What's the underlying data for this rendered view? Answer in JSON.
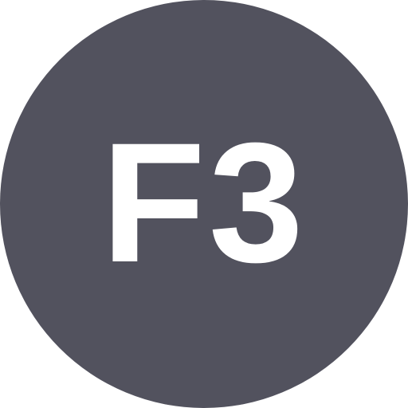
{
  "badge": {
    "label": "F3",
    "icon": "function-key-f3-icon",
    "background_color": "#52525e",
    "text_color": "#ffffff"
  }
}
